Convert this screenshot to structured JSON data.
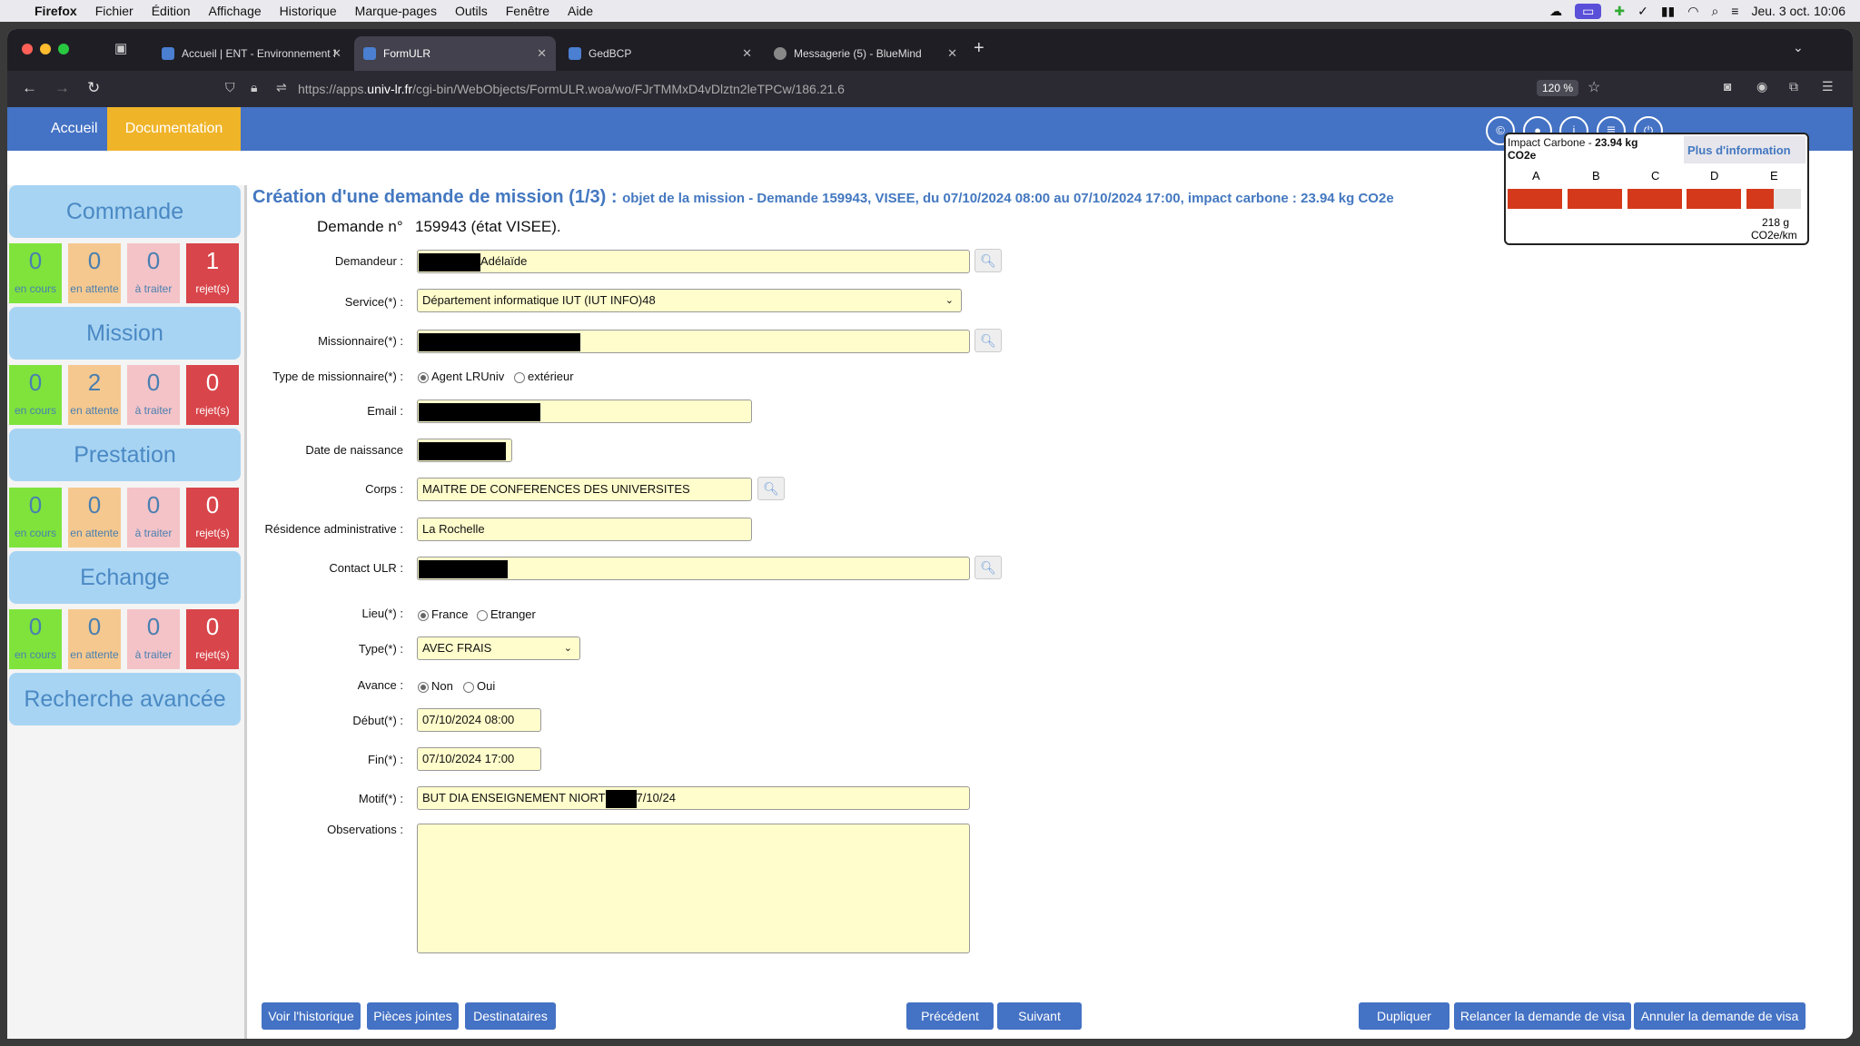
{
  "menubar": {
    "app": "Firefox",
    "items": [
      "Fichier",
      "Édition",
      "Affichage",
      "Historique",
      "Marque-pages",
      "Outils",
      "Fenêtre",
      "Aide"
    ],
    "clock": "Jeu. 3 oct.  10:06"
  },
  "tabs": [
    {
      "label": "Accueil | ENT - Environnement N"
    },
    {
      "label": "FormULR"
    },
    {
      "label": "GedBCP"
    },
    {
      "label": "Messagerie (5) - BlueMind"
    }
  ],
  "url": {
    "pre": "https://apps.",
    "host": "univ-lr.fr",
    "post": "/cgi-bin/WebObjects/FormULR.woa/wo/FJrTMMxD4vDlztn2leTPCw/186.21.6"
  },
  "zoom": "120 %",
  "nav": {
    "home": "Accueil",
    "doc": "Documentation"
  },
  "sidebar": {
    "sections": [
      {
        "title": "Commande",
        "counts": [
          "0",
          "0",
          "0",
          "1"
        ]
      },
      {
        "title": "Mission",
        "counts": [
          "0",
          "2",
          "0",
          "0"
        ]
      },
      {
        "title": "Prestation",
        "counts": [
          "0",
          "0",
          "0",
          "0"
        ]
      },
      {
        "title": "Echange",
        "counts": [
          "0",
          "0",
          "0",
          "0"
        ]
      }
    ],
    "count_labels": [
      "en cours",
      "en attente",
      "à traiter",
      "rejet(s)"
    ],
    "advanced": "Recherche avancée"
  },
  "form": {
    "title": "Création d'une demande de mission (1/3) :",
    "subtitle": "objet de la mission - Demande 159943, VISEE, du 07/10/2024 08:00 au 07/10/2024 17:00, impact carbone : 23.94 kg CO2e",
    "demande_label": "Demande n°",
    "demande_value": "159943 (état VISEE).",
    "labels": {
      "demandeur": "Demandeur :",
      "service": "Service(*) :",
      "missionnaire": "Missionnaire(*) :",
      "type_missionnaire": "Type de missionnaire(*) :",
      "email": "Email :",
      "naissance": "Date de naissance",
      "corps": "Corps :",
      "residence": "Résidence administrative :",
      "contact": "Contact ULR :",
      "lieu": "Lieu(*) :",
      "type": "Type(*) :",
      "avance": "Avance :",
      "debut": "Début(*) :",
      "fin": "Fin(*) :",
      "motif": "Motif(*) :",
      "observations": "Observations :"
    },
    "values": {
      "demandeur": "Adélaïde",
      "service": "Département informatique IUT (IUT INFO)48",
      "corps": "MAITRE DE CONFERENCES DES UNIVERSITES",
      "residence": "La Rochelle",
      "type": "AVEC FRAIS",
      "debut": "07/10/2024 08:00",
      "fin": "07/10/2024 17:00",
      "motif_a": "BUT DIA ENSEIGNEMENT NIORT",
      "motif_b": "7/10/24"
    },
    "radios": {
      "agent": "Agent LRUniv",
      "exterieur": "extérieur",
      "france": "France",
      "etranger": "Etranger",
      "non": "Non",
      "oui": "Oui"
    }
  },
  "impact": {
    "title": "Impact Carbone -",
    "value": "23.94 kg",
    "unit": "CO2e",
    "link": "Plus d'information",
    "grades": [
      "A",
      "B",
      "C",
      "D",
      "E"
    ],
    "level": "218 g",
    "level_unit": "CO2e/km"
  },
  "buttons": {
    "historique": "Voir l'historique",
    "pieces": "Pièces jointes",
    "destinataires": "Destinataires",
    "precedent": "Précédent",
    "suivant": "Suivant",
    "dupliquer": "Dupliquer",
    "relancer": "Relancer la demande de visa",
    "annuler": "Annuler la demande de visa"
  },
  "colors": {
    "accent": "#4472c4",
    "doc_tab": "#f0b429",
    "field": "#fffdcc",
    "bar": "#d4391c"
  }
}
